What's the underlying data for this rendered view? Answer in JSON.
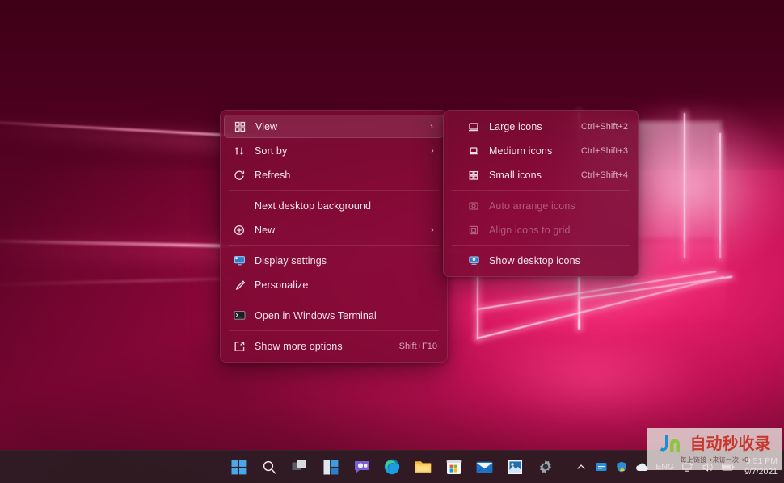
{
  "desktop": {
    "wallpaper_name": "windows-hero-pink-wallpaper",
    "accent_color": "#e0145f",
    "dark_color": "#47001c"
  },
  "context_menu": {
    "name": "desktop-context-menu",
    "items": [
      {
        "id": "view",
        "label": "View",
        "icon": "grid-icon",
        "accel": "",
        "submenu": true,
        "highlighted": true,
        "disabled": false
      },
      {
        "id": "sort-by",
        "label": "Sort by",
        "icon": "sort-icon",
        "accel": "",
        "submenu": true,
        "highlighted": false,
        "disabled": false
      },
      {
        "id": "refresh",
        "label": "Refresh",
        "icon": "refresh-icon",
        "accel": "",
        "submenu": false,
        "highlighted": false,
        "disabled": false
      },
      {
        "id": "separator-1",
        "label": "",
        "icon": "",
        "accel": "",
        "submenu": false,
        "highlighted": false,
        "disabled": false
      },
      {
        "id": "next-desktop-background",
        "label": "Next desktop background",
        "icon": "",
        "accel": "",
        "submenu": false,
        "highlighted": false,
        "disabled": false
      },
      {
        "id": "new",
        "label": "New",
        "icon": "plus-circle-icon",
        "accel": "",
        "submenu": true,
        "highlighted": false,
        "disabled": false
      },
      {
        "id": "separator-2",
        "label": "",
        "icon": "",
        "accel": "",
        "submenu": false,
        "highlighted": false,
        "disabled": false
      },
      {
        "id": "display-settings",
        "label": "Display settings",
        "icon": "monitor-icon",
        "accel": "",
        "submenu": false,
        "highlighted": false,
        "disabled": false
      },
      {
        "id": "personalize",
        "label": "Personalize",
        "icon": "brush-icon",
        "accel": "",
        "submenu": false,
        "highlighted": false,
        "disabled": false
      },
      {
        "id": "separator-3",
        "label": "",
        "icon": "",
        "accel": "",
        "submenu": false,
        "highlighted": false,
        "disabled": false
      },
      {
        "id": "open-in-windows-terminal",
        "label": "Open in Windows Terminal",
        "icon": "terminal-icon",
        "accel": "",
        "submenu": false,
        "highlighted": false,
        "disabled": false
      },
      {
        "id": "separator-4",
        "label": "",
        "icon": "",
        "accel": "",
        "submenu": false,
        "highlighted": false,
        "disabled": false
      },
      {
        "id": "show-more-options",
        "label": "Show more options",
        "icon": "expand-icon",
        "accel": "Shift+F10",
        "submenu": false,
        "highlighted": false,
        "disabled": false
      }
    ]
  },
  "view_submenu": {
    "name": "view-submenu",
    "items": [
      {
        "id": "large-icons",
        "label": "Large icons",
        "icon": "large-icons-icon",
        "accel": "Ctrl+Shift+2",
        "selected": true,
        "disabled": false
      },
      {
        "id": "medium-icons",
        "label": "Medium icons",
        "icon": "medium-icons-icon",
        "accel": "Ctrl+Shift+3",
        "selected": false,
        "disabled": false
      },
      {
        "id": "small-icons",
        "label": "Small icons",
        "icon": "small-icons-icon",
        "accel": "Ctrl+Shift+4",
        "selected": false,
        "disabled": false
      },
      {
        "id": "separator-1",
        "label": "",
        "icon": "",
        "accel": "",
        "selected": false,
        "disabled": false
      },
      {
        "id": "auto-arrange-icons",
        "label": "Auto arrange icons",
        "icon": "auto-arrange-icon",
        "accel": "",
        "selected": false,
        "disabled": true
      },
      {
        "id": "align-icons-to-grid",
        "label": "Align icons to grid",
        "icon": "align-grid-icon",
        "accel": "",
        "selected": false,
        "disabled": true
      },
      {
        "id": "separator-2",
        "label": "",
        "icon": "",
        "accel": "",
        "selected": false,
        "disabled": false
      },
      {
        "id": "show-desktop-icons",
        "label": "Show desktop icons",
        "icon": "desktop-icons-icon",
        "accel": "",
        "selected": false,
        "disabled": false
      }
    ]
  },
  "taskbar": {
    "items": [
      {
        "id": "start",
        "label": "Start",
        "icon": "windows-start-icon",
        "active": false
      },
      {
        "id": "search",
        "label": "Search",
        "icon": "search-icon",
        "active": false
      },
      {
        "id": "task-view",
        "label": "Task View",
        "icon": "task-view-icon",
        "active": false
      },
      {
        "id": "widgets",
        "label": "Widgets",
        "icon": "widgets-icon",
        "active": false
      },
      {
        "id": "chat",
        "label": "Chat",
        "icon": "chat-teams-icon",
        "active": false
      },
      {
        "id": "edge",
        "label": "Microsoft Edge",
        "icon": "edge-icon",
        "active": false
      },
      {
        "id": "file-explorer",
        "label": "File Explorer",
        "icon": "file-explorer-icon",
        "active": false
      },
      {
        "id": "microsoft-store",
        "label": "Microsoft Store",
        "icon": "microsoft-store-icon",
        "active": false
      },
      {
        "id": "mail",
        "label": "Mail",
        "icon": "mail-icon",
        "active": false
      },
      {
        "id": "photos",
        "label": "Photos",
        "icon": "photos-icon",
        "active": false
      },
      {
        "id": "settings",
        "label": "Settings",
        "icon": "settings-gear-icon",
        "active": false
      }
    ],
    "tray": {
      "overflow_icon": "chevron-up-icon",
      "icons": [
        {
          "id": "tray-app-blue",
          "icon": "blue-app-icon"
        },
        {
          "id": "tray-security",
          "icon": "security-warning-icon"
        },
        {
          "id": "tray-onedrive",
          "icon": "onedrive-cloud-icon"
        }
      ],
      "language": "ENG",
      "network_icon": "network-icon",
      "volume_icon": "volume-icon",
      "battery_icon": "battery-icon"
    },
    "clock": {
      "time": "9:51 PM",
      "date": "9/7/2021"
    }
  },
  "watermark": {
    "logo_text": "Jn",
    "title": "自动秒收录",
    "subtitle": "每上链接→来访一次→0",
    "title_color": "#c7382f",
    "logo_blue": "#1a8fd1",
    "logo_green": "#8cc63f"
  }
}
